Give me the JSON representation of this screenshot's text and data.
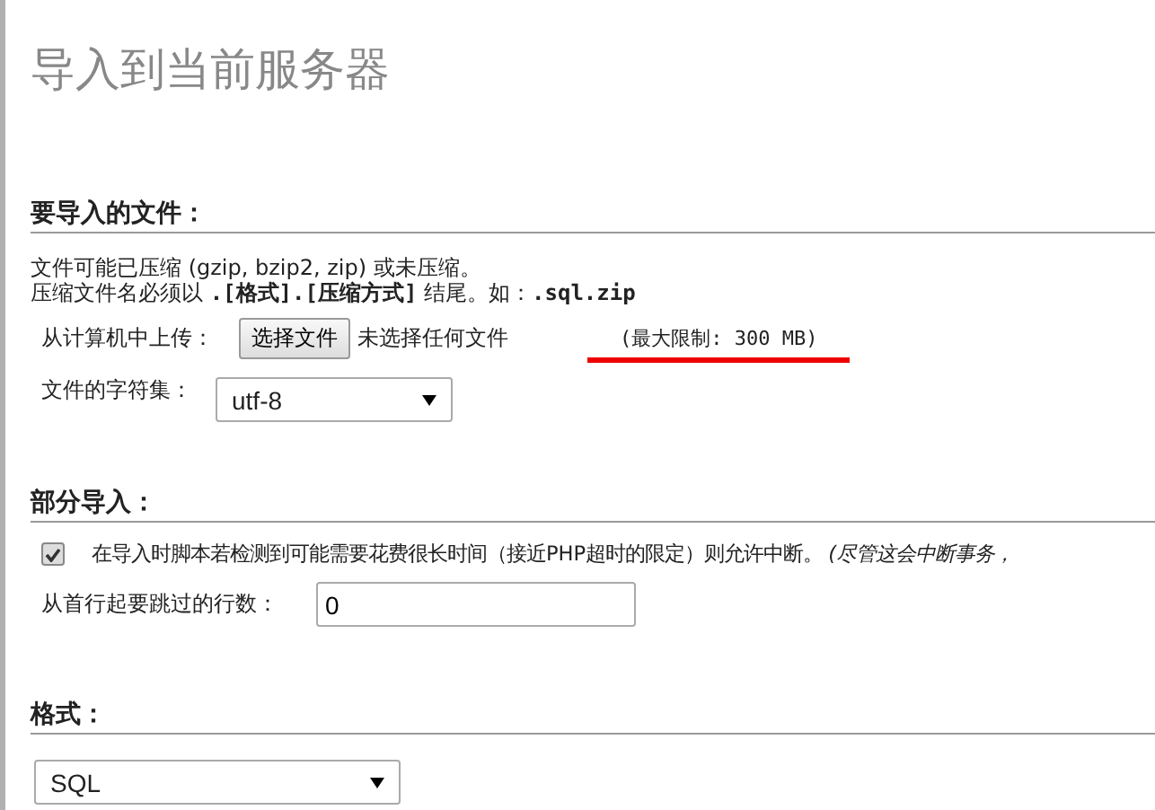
{
  "title": "导入到当前服务器",
  "file_section": {
    "heading": "要导入的文件：",
    "note_line_1": "文件可能已压缩 (gzip, bzip2, zip) 或未压缩。",
    "note_line_2": "压缩文件名必须以 **.[格式].[压缩方式]** 结尾。如：**.sql.zip**",
    "upload_label": "从计算机中上传：",
    "choose_button": "选择文件",
    "no_file_text": "未选择任何文件",
    "max_limit": "(最大限制: 300 MB)",
    "max_limit_underlined": true,
    "charset_label": "文件的字符集：",
    "charset_value": "utf-8"
  },
  "partial_section": {
    "heading": "部分导入：",
    "allow_interrupt": {
      "checked": true,
      "label": "在导入时脚本若检测到可能需要花费很长时间（接近PHP超时的限定）则允许中断。",
      "hint": "(尽管这会中断事务，"
    },
    "skip_label": "从首行起要跳过的行数：",
    "skip_value": "0"
  },
  "format_section": {
    "heading": "格式：",
    "format_value": "SQL"
  }
}
